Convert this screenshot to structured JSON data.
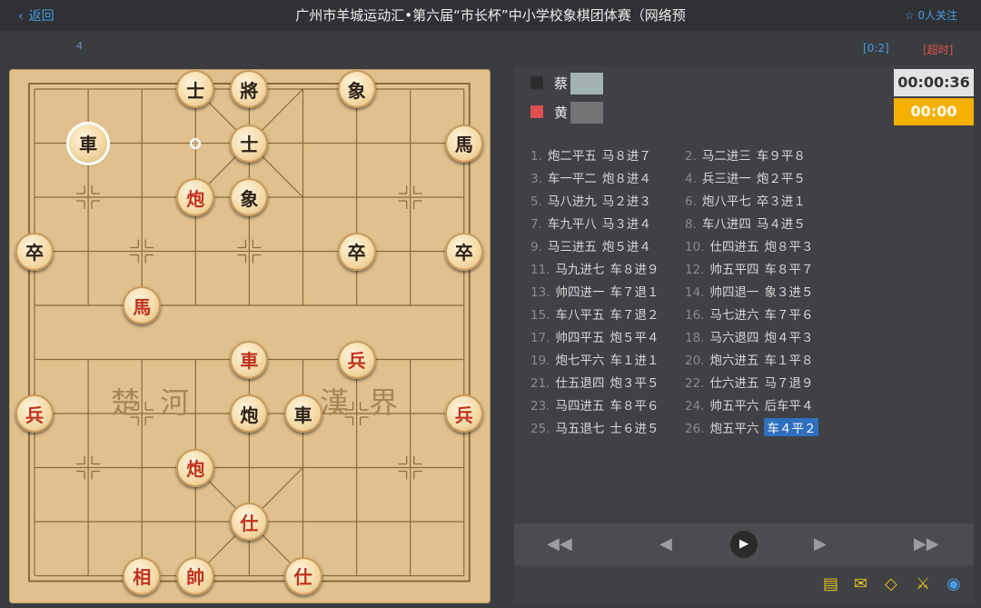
{
  "header": {
    "back_label": "返回",
    "title": "广州市羊城运动汇•第六届“市长杯”中小学校象棋团体赛（网络预",
    "follow_label": "0人关注"
  },
  "subbar": {
    "round": "4",
    "score": "[0:2]",
    "timeout": "[超时]"
  },
  "board": {
    "river_left": "楚 河",
    "river_right": "漢 界",
    "pieces": [
      {
        "char": "士",
        "color": "black",
        "col": 3,
        "row": 0
      },
      {
        "char": "將",
        "color": "black",
        "col": 4,
        "row": 0
      },
      {
        "char": "象",
        "color": "black",
        "col": 6,
        "row": 0
      },
      {
        "char": "車",
        "color": "black",
        "col": 1,
        "row": 1,
        "selected": true
      },
      {
        "char": "士",
        "color": "black",
        "col": 4,
        "row": 1
      },
      {
        "char": "馬",
        "color": "black",
        "col": 8,
        "row": 1
      },
      {
        "char": "炮",
        "color": "red",
        "col": 3,
        "row": 2
      },
      {
        "char": "象",
        "color": "black",
        "col": 4,
        "row": 2
      },
      {
        "char": "卒",
        "color": "black",
        "col": 0,
        "row": 3
      },
      {
        "char": "卒",
        "color": "black",
        "col": 6,
        "row": 3
      },
      {
        "char": "卒",
        "color": "black",
        "col": 8,
        "row": 3
      },
      {
        "char": "馬",
        "color": "red",
        "col": 2,
        "row": 4
      },
      {
        "char": "車",
        "color": "red",
        "col": 4,
        "row": 5
      },
      {
        "char": "兵",
        "color": "red",
        "col": 6,
        "row": 5
      },
      {
        "char": "兵",
        "color": "red",
        "col": 0,
        "row": 6
      },
      {
        "char": "炮",
        "color": "black",
        "col": 4,
        "row": 6
      },
      {
        "char": "車",
        "color": "black",
        "col": 5,
        "row": 6
      },
      {
        "char": "兵",
        "color": "red",
        "col": 8,
        "row": 6
      },
      {
        "char": "炮",
        "color": "red",
        "col": 3,
        "row": 7
      },
      {
        "char": "仕",
        "color": "red",
        "col": 4,
        "row": 8
      },
      {
        "char": "相",
        "color": "red",
        "col": 2,
        "row": 9
      },
      {
        "char": "帥",
        "color": "red",
        "col": 3,
        "row": 9
      },
      {
        "char": "仕",
        "color": "red",
        "col": 5,
        "row": 9
      }
    ],
    "last_move_marker": {
      "col": 3,
      "row": 1
    }
  },
  "players": [
    {
      "name": "蔡",
      "color": "#2c2c2c",
      "clock": "00:00:36"
    },
    {
      "name": "黄",
      "color": "#e05050",
      "clock": "00:00"
    }
  ],
  "moves": [
    {
      "n": "1.",
      "a": "炮二平五",
      "b": "马８进７"
    },
    {
      "n": "2.",
      "a": "马二进三",
      "b": "车９平８"
    },
    {
      "n": "3.",
      "a": "车一平二",
      "b": "炮８进４"
    },
    {
      "n": "4.",
      "a": "兵三进一",
      "b": "炮２平５"
    },
    {
      "n": "5.",
      "a": "马八进九",
      "b": "马２进３"
    },
    {
      "n": "6.",
      "a": "炮八平七",
      "b": "卒３进１"
    },
    {
      "n": "7.",
      "a": "车九平八",
      "b": "马３进４"
    },
    {
      "n": "8.",
      "a": "车八进四",
      "b": "马４进５"
    },
    {
      "n": "9.",
      "a": "马三进五",
      "b": "炮５进４"
    },
    {
      "n": "10.",
      "a": "仕四进五",
      "b": "炮８平３"
    },
    {
      "n": "11.",
      "a": "马九进七",
      "b": "车８进９"
    },
    {
      "n": "12.",
      "a": "帅五平四",
      "b": "车８平７"
    },
    {
      "n": "13.",
      "a": "帅四进一",
      "b": "车７退１"
    },
    {
      "n": "14.",
      "a": "帅四退一",
      "b": "象３进５"
    },
    {
      "n": "15.",
      "a": "车八平五",
      "b": "车７退２"
    },
    {
      "n": "16.",
      "a": "马七进六",
      "b": "车７平６"
    },
    {
      "n": "17.",
      "a": "帅四平五",
      "b": "炮５平４"
    },
    {
      "n": "18.",
      "a": "马六退四",
      "b": "炮４平３"
    },
    {
      "n": "19.",
      "a": "炮七平六",
      "b": "车１进１"
    },
    {
      "n": "20.",
      "a": "炮六进五",
      "b": "车１平８"
    },
    {
      "n": "21.",
      "a": "仕五退四",
      "b": "炮３平５"
    },
    {
      "n": "22.",
      "a": "仕六进五",
      "b": "马７退９"
    },
    {
      "n": "23.",
      "a": "马四进五",
      "b": "车８平６"
    },
    {
      "n": "24.",
      "a": "帅五平六",
      "b": "后车平４"
    },
    {
      "n": "25.",
      "a": "马五退七",
      "b": "士６进５"
    },
    {
      "n": "26.",
      "a": "炮五平六",
      "b": "车４平２",
      "highlight": true
    }
  ],
  "controls": {
    "first": "◀◀",
    "prev": "◀",
    "play": "▶",
    "next": "▶",
    "last": "▶▶"
  },
  "icons": {
    "back": "chevron-left-icon",
    "follow": "star-icon",
    "note": "note-icon",
    "mail": "mail-icon",
    "tag": "tag-icon",
    "swords": "swords-icon",
    "eye": "eye-icon"
  },
  "tools": {
    "note": "▤",
    "mail": "✉",
    "tag": "◇",
    "swords": "⚔",
    "eye": "◉"
  }
}
